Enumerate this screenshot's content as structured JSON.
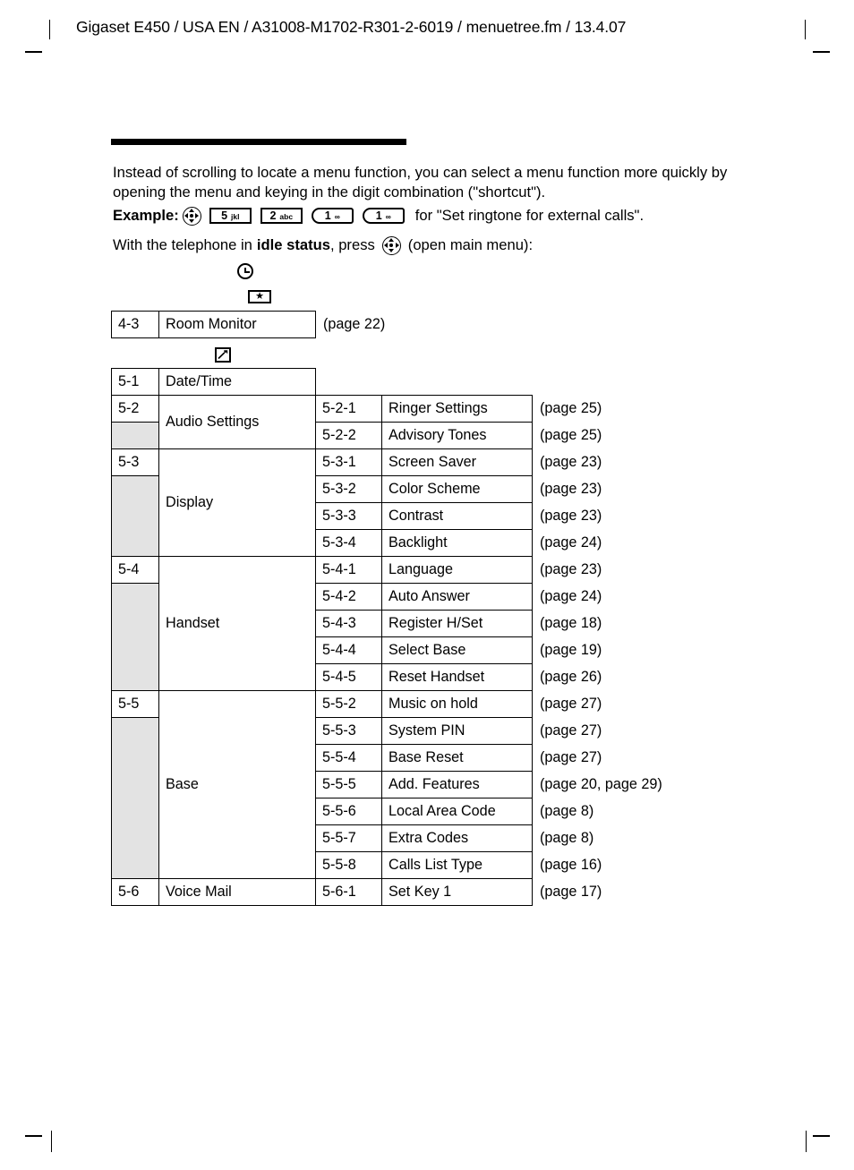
{
  "page": {
    "header": "Gigaset E450 / USA EN / A31008-M1702-R301-2-6019 / menuetree.fm / 13.4.07"
  },
  "intro": {
    "paragraph": "Instead of scrolling to locate a menu function, you can select a menu function more quickly by opening the menu and keying in the digit combination (\"shortcut\").",
    "example_label": "Example:",
    "example_tail": "for \"Set ringtone for external calls\".",
    "idle_prefix": "With the telephone in",
    "idle_bold": "idle status",
    "idle_mid": ", press",
    "idle_suffix": "(open main menu):",
    "keys": [
      {
        "icon": "nav-rocker-icon"
      },
      {
        "num": "5",
        "sub": "jkl",
        "shape": "square"
      },
      {
        "num": "2",
        "sub": "abc",
        "shape": "square"
      },
      {
        "num": "1",
        "sub": "∞",
        "shape": "round"
      },
      {
        "num": "1",
        "sub": "∞",
        "shape": "round"
      }
    ]
  },
  "icons": {
    "clock": "clock-icon",
    "star": "★",
    "star_name": "star-key-icon",
    "wrench": "wrench-settings-icon"
  },
  "room_monitor": {
    "rows": [
      {
        "code": "4-3",
        "name": "Room Monitor",
        "page": "(page 22)"
      }
    ]
  },
  "settings": {
    "groups": [
      {
        "code": "5-1",
        "name": "Date/Time",
        "children": []
      },
      {
        "code": "5-2",
        "name": "Audio Settings",
        "children": [
          {
            "code": "5-2-1",
            "name": "Ringer Settings",
            "page": "(page 25)"
          },
          {
            "code": "5-2-2",
            "name": "Advisory Tones",
            "page": "(page 25)"
          }
        ]
      },
      {
        "code": "5-3",
        "name": "Display",
        "children": [
          {
            "code": "5-3-1",
            "name": "Screen Saver",
            "page": "(page 23)"
          },
          {
            "code": "5-3-2",
            "name": "Color Scheme",
            "page": "(page 23)"
          },
          {
            "code": "5-3-3",
            "name": "Contrast",
            "page": "(page 23)"
          },
          {
            "code": "5-3-4",
            "name": "Backlight",
            "page": "(page 24)"
          }
        ]
      },
      {
        "code": "5-4",
        "name": "Handset",
        "children": [
          {
            "code": "5-4-1",
            "name": "Language",
            "page": "(page 23)"
          },
          {
            "code": "5-4-2",
            "name": "Auto Answer",
            "page": "(page 24)"
          },
          {
            "code": "5-4-3",
            "name": "Register H/Set",
            "page": "(page 18)"
          },
          {
            "code": "5-4-4",
            "name": "Select Base",
            "page": "(page 19)"
          },
          {
            "code": "5-4-5",
            "name": "Reset Handset",
            "page": "(page 26)"
          }
        ]
      },
      {
        "code": "5-5",
        "name": "Base",
        "children": [
          {
            "code": "5-5-2",
            "name": "Music on hold",
            "page": "(page 27)"
          },
          {
            "code": "5-5-3",
            "name": "System PIN",
            "page": "(page 27)"
          },
          {
            "code": "5-5-4",
            "name": "Base Reset",
            "page": "(page 27)"
          },
          {
            "code": "5-5-5",
            "name": "Add. Features",
            "page": "(page 20, page 29)"
          },
          {
            "code": "5-5-6",
            "name": "Local Area Code",
            "page": "(page 8)"
          },
          {
            "code": "5-5-7",
            "name": "Extra Codes",
            "page": "(page 8)"
          },
          {
            "code": "5-5-8",
            "name": "Calls List Type",
            "page": "(page 16)"
          }
        ]
      },
      {
        "code": "5-6",
        "name": "Voice Mail",
        "children": [
          {
            "code": "5-6-1",
            "name": "Set Key 1",
            "page": "(page 17)"
          }
        ]
      }
    ]
  }
}
